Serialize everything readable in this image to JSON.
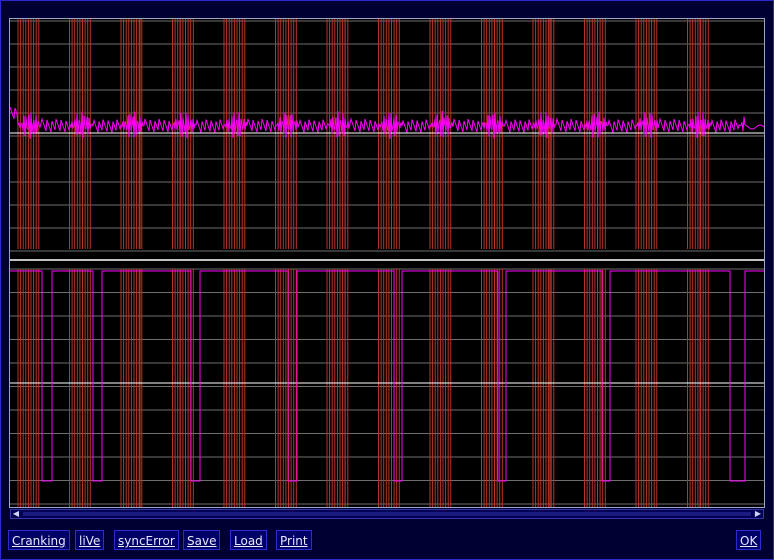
{
  "colors": {
    "background": "#000033",
    "scope_background": "#000000",
    "grid": "#b5b5b5",
    "tooth_markers": "#c0392b",
    "signal": "#ff00ff",
    "baseline": "#ffffff"
  },
  "toolbar": {
    "cranking_label": "Cranking",
    "live_label": "liVe",
    "sync_error_label": "syncError",
    "save_label": "Save",
    "load_label": "Load",
    "print_label": "Print",
    "ok_label": "OK"
  },
  "scrollbar": {
    "left_arrow_icon": "arrow-left-icon",
    "right_arrow_icon": "arrow-right-icon"
  }
}
